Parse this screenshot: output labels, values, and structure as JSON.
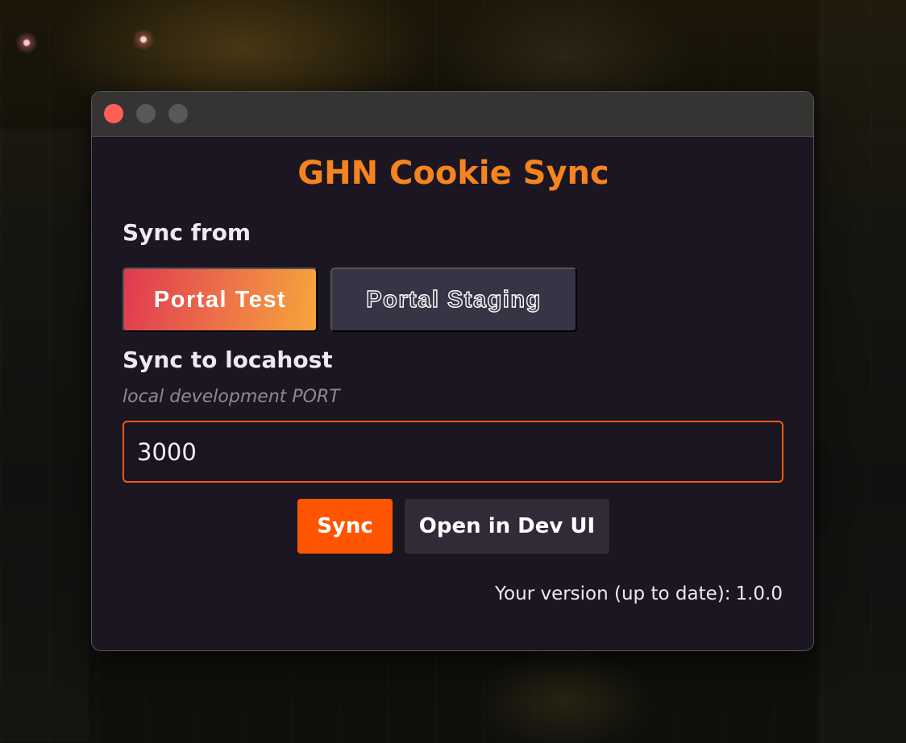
{
  "window": {
    "controls": [
      "close",
      "minimize",
      "maximize"
    ]
  },
  "app": {
    "title": "GHN Cookie Sync"
  },
  "sync_from": {
    "label": "Sync from",
    "options": [
      {
        "label": "Portal Test",
        "selected": true
      },
      {
        "label": "Portal Staging",
        "selected": false
      }
    ]
  },
  "sync_to": {
    "label": "Sync to locahost",
    "hint": "local development PORT",
    "port_value": "3000"
  },
  "actions": {
    "sync_label": "Sync",
    "devui_label": "Open in Dev UI"
  },
  "version": {
    "label": "Your version (up to date):",
    "value": "1.0.0"
  },
  "colors": {
    "accent": "#f5841f",
    "primary_button": "#ff5500",
    "input_border": "#ef5a14",
    "close_light": "#fe5f57",
    "window_bg": "#1b1622"
  }
}
